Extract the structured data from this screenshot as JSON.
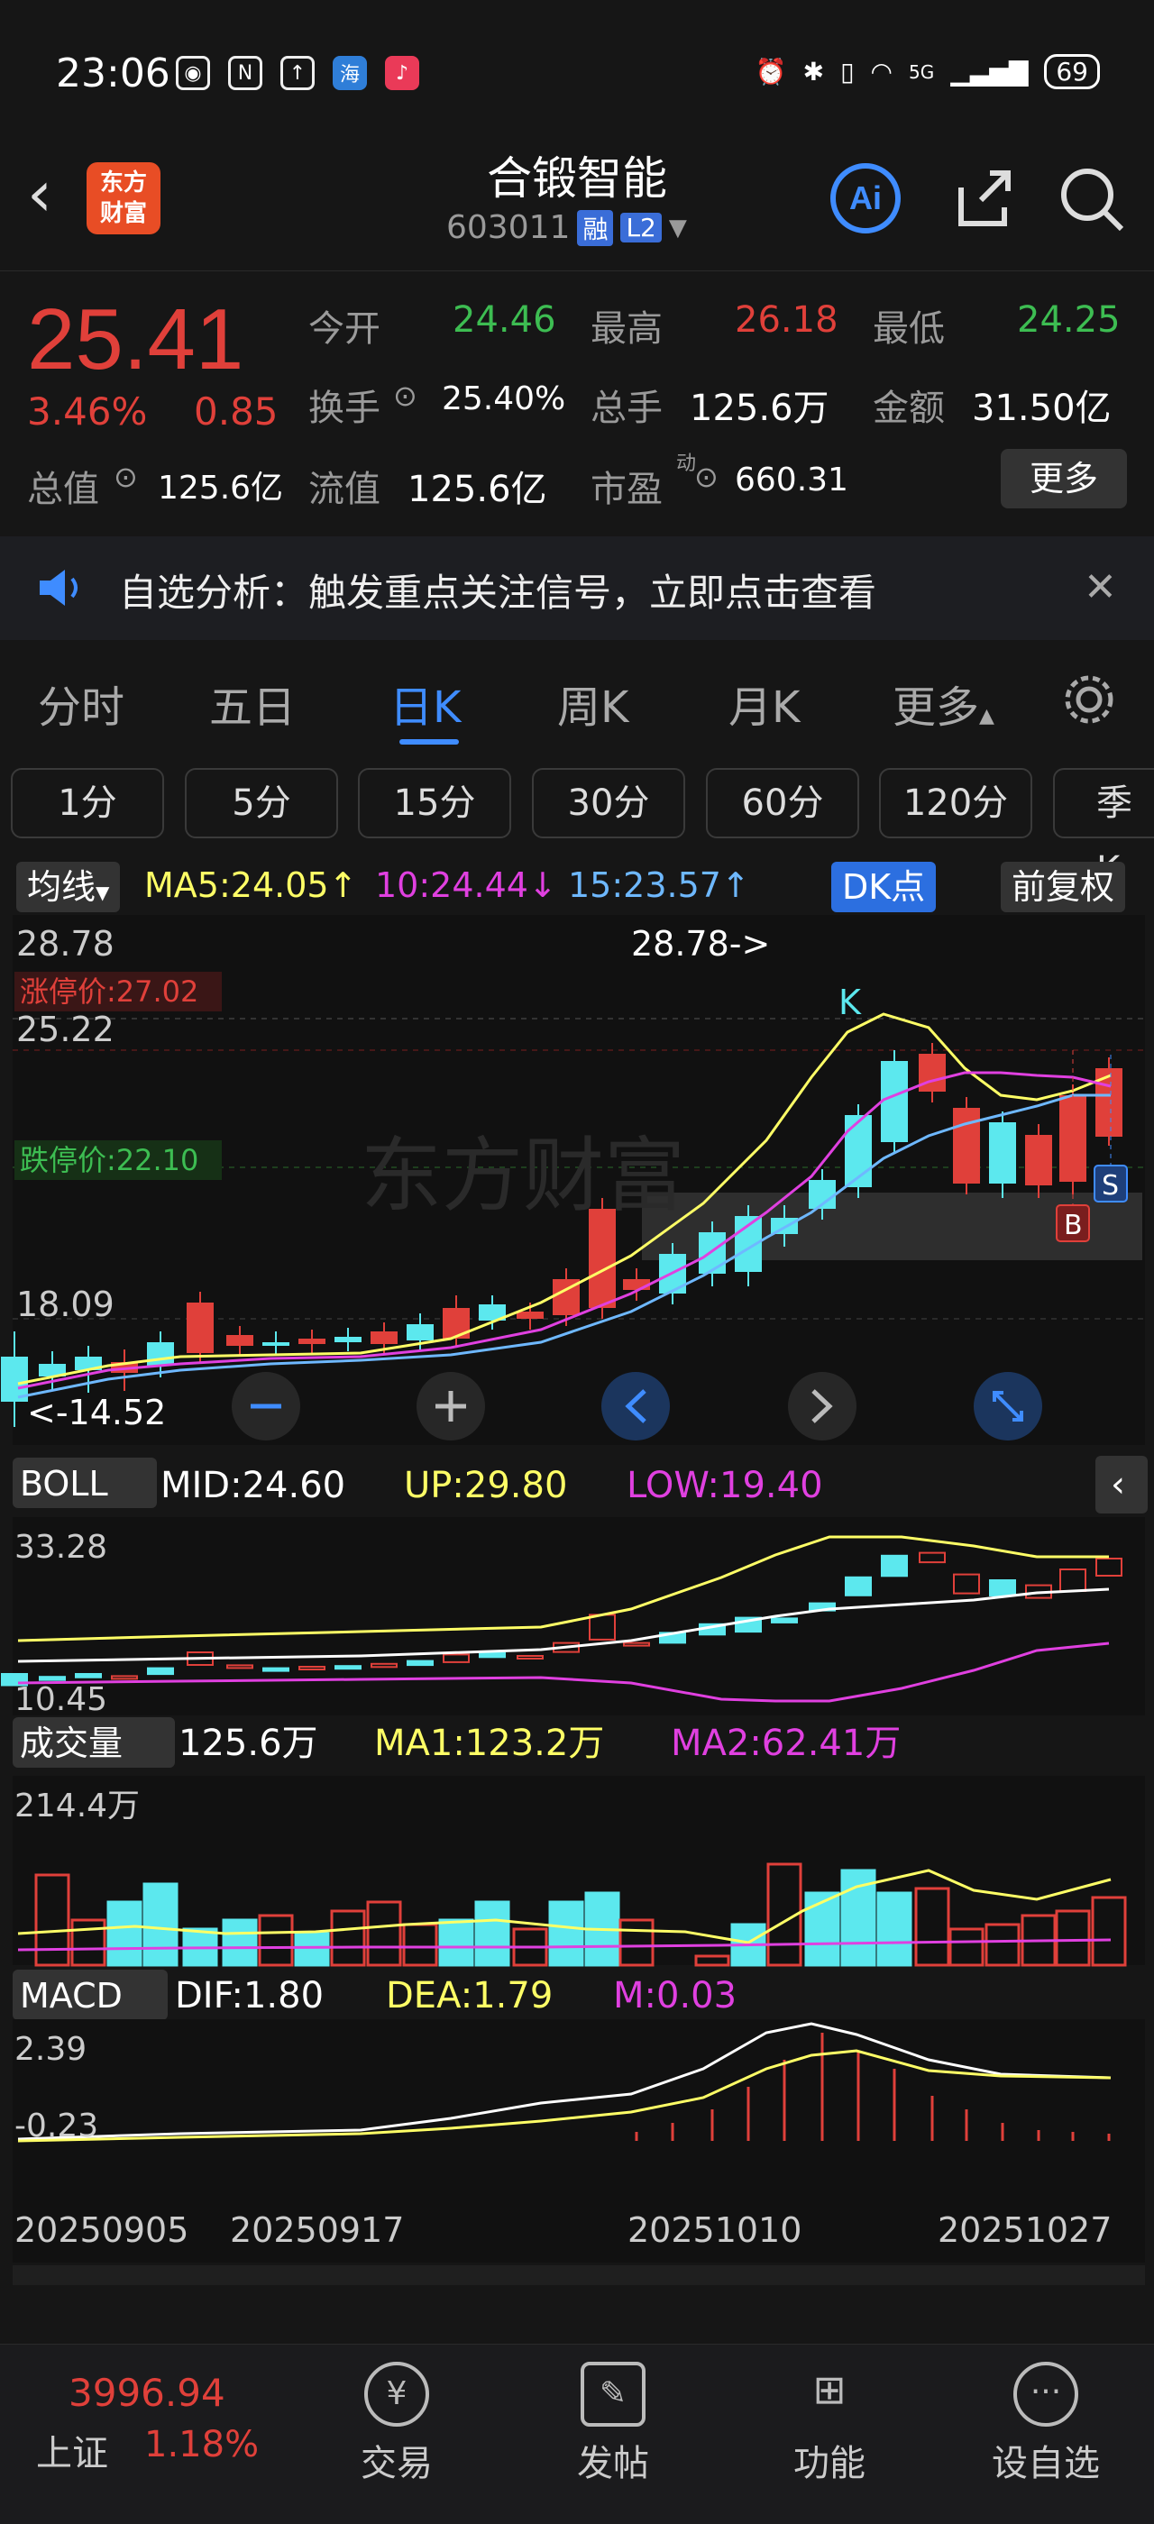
{
  "status_bar": {
    "time": "23:06",
    "network": "5G",
    "battery": "69"
  },
  "header": {
    "logo_line1": "东方",
    "logo_line2": "财富",
    "title": "合锻智能",
    "code": "603011",
    "tag_margin": "融",
    "tag_level": "L2"
  },
  "quote": {
    "price": "25.41",
    "pct": "3.46%",
    "change": "0.85",
    "open_label": "今开",
    "open": "24.46",
    "high_label": "最高",
    "high": "26.18",
    "low_label": "最低",
    "low": "24.25",
    "turnover_label": "换手",
    "turnover": "25.40%",
    "volume_label": "总手",
    "volume": "125.6万",
    "amount_label": "金额",
    "amount": "31.50亿",
    "mktcap_label": "总值",
    "mktcap": "125.6亿",
    "float_label": "流值",
    "float": "125.6亿",
    "pe_label": "市盈",
    "pe_sup": "动",
    "pe": "660.31",
    "more": "更多"
  },
  "notice": {
    "text": "自选分析：触发重点关注信号，立即点击查看"
  },
  "tabs": [
    "分时",
    "五日",
    "日K",
    "周K",
    "月K",
    "更多"
  ],
  "active_tab": "日K",
  "periods": [
    "1分",
    "5分",
    "15分",
    "30分",
    "60分",
    "120分",
    "季K"
  ],
  "ma": {
    "label": "均线",
    "ma5": "MA5:24.05",
    "ma10": "10:24.44",
    "ma15": "15:23.57",
    "dk": "DK点",
    "adjust": "前复权"
  },
  "kline": {
    "top_price": "28.78",
    "limit_up": "涨停价:27.02",
    "p2": "25.22",
    "limit_down": "跌停价:22.10",
    "p3": "18.09",
    "bottom_price": "14.52",
    "high_marker": "28.78->",
    "low_marker": "<-14.52",
    "k_label": "K",
    "s_label": "S",
    "b_label": "B",
    "watermark": "东方财富"
  },
  "boll": {
    "label": "BOLL",
    "mid": "MID:24.60",
    "up": "UP:29.80",
    "low": "LOW:19.40",
    "top": "33.28",
    "bottom": "10.45"
  },
  "volume": {
    "label": "成交量",
    "value": "125.6万",
    "ma1": "MA1:123.2万",
    "ma2": "MA2:62.41万",
    "top": "214.4万"
  },
  "macd": {
    "label": "MACD",
    "dif": "DIF:1.80",
    "dea": "DEA:1.79",
    "m": "M:0.03",
    "top": "2.39",
    "bottom": "-0.23"
  },
  "dates": [
    "20250905",
    "20250917",
    "20251010",
    "20251027"
  ],
  "bottom_nav": {
    "index_value": "3996.94",
    "index_name": "上证",
    "index_pct": "1.18%",
    "items": [
      "交易",
      "发帖",
      "功能",
      "设自选"
    ]
  },
  "colors": {
    "up": "#e0403a",
    "down": "#5ce8ee",
    "ma5": "#ffff66",
    "ma10": "#e040e0",
    "ma15": "#6eb8ff",
    "accent": "#3f8cff"
  }
}
